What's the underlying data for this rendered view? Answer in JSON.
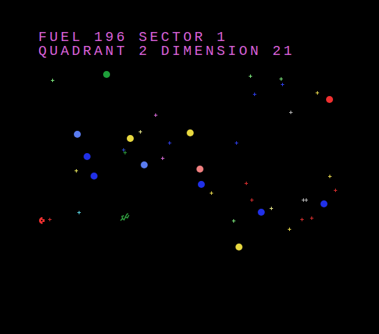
{
  "hud": {
    "lines": [
      "FUEL 196 SECTOR 1",
      "QUADRANT 2 DIMENSION 21"
    ]
  },
  "planets": [
    {
      "color": "#1e9e3a"
    },
    {
      "color": "#f03030"
    },
    {
      "color": "#5a7cf0"
    },
    {
      "color": "#e8d840"
    },
    {
      "color": "#e8d840"
    },
    {
      "color": "#2030e8"
    },
    {
      "color": "#5a7cf0"
    },
    {
      "color": "#f08080"
    },
    {
      "color": "#2030e8"
    },
    {
      "color": "#2030e8"
    },
    {
      "color": "#2030e8"
    },
    {
      "color": "#2030e8"
    },
    {
      "color": "#e8d840"
    }
  ],
  "stars": [
    {
      "color": "#80f080"
    },
    {
      "color": "#80f080"
    },
    {
      "color": "#80f080"
    },
    {
      "color": "#3040f0"
    },
    {
      "color": "#3040f0"
    },
    {
      "color": "#f0e050"
    },
    {
      "color": "#c0c0c0"
    },
    {
      "color": "#e070e0"
    },
    {
      "color": "#f0f090"
    },
    {
      "color": "#3040f0"
    },
    {
      "color": "#3040f0"
    },
    {
      "color": "#3050d0"
    },
    {
      "color": "#30a040"
    },
    {
      "color": "#e070e0"
    },
    {
      "color": "#f0f060"
    },
    {
      "color": "#f0e050"
    },
    {
      "color": "#e03030"
    },
    {
      "color": "#e03030"
    },
    {
      "color": "#f0e050"
    },
    {
      "color": "#e03030"
    },
    {
      "color": "#c0c0c0"
    },
    {
      "color": "#c0c0c0"
    },
    {
      "color": "#f0f090"
    },
    {
      "color": "#60e0f0"
    },
    {
      "color": "#80f080"
    },
    {
      "color": "#e03030"
    },
    {
      "color": "#e03030"
    },
    {
      "color": "#f0e050"
    },
    {
      "color": "#e03030"
    }
  ]
}
